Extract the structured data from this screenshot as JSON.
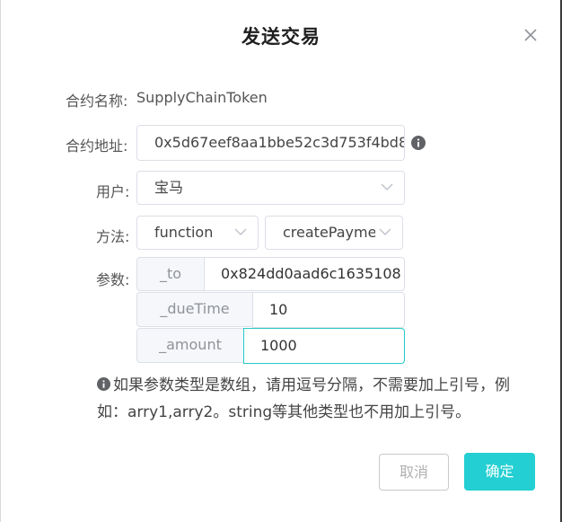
{
  "dialog": {
    "title": "发送交易",
    "close_icon": "close-icon"
  },
  "contract": {
    "name_label": "合约名称:",
    "name_value": "SupplyChainToken",
    "address_label": "合约地址:",
    "address_value": "0x5d67eef8aa1bbe52c3d753f4bd8",
    "address_icon": "info-icon"
  },
  "user": {
    "label": "用户:",
    "selected": "宝马"
  },
  "method": {
    "label": "方法:",
    "type_selected": "function",
    "name_selected": "createPayme"
  },
  "params": {
    "label": "参数:",
    "items": [
      {
        "name": "_to",
        "value": "0x824dd0aad6c1635108"
      },
      {
        "name": "_dueTime",
        "value": "10"
      },
      {
        "name": "_amount",
        "value": "1000"
      }
    ]
  },
  "tip": {
    "icon": "info-icon",
    "text": "如果参数类型是数组，请用逗号分隔，不需要加上引号，例如：arry1,arry2。string等其他类型也不用加上引号。"
  },
  "buttons": {
    "cancel_label": "取消",
    "ok_label": "确定"
  },
  "colors": {
    "accent": "#23cfd2",
    "focus_border": "#26c9c9",
    "border": "#dcdfe6",
    "prepend_bg": "#f5f7fa"
  }
}
